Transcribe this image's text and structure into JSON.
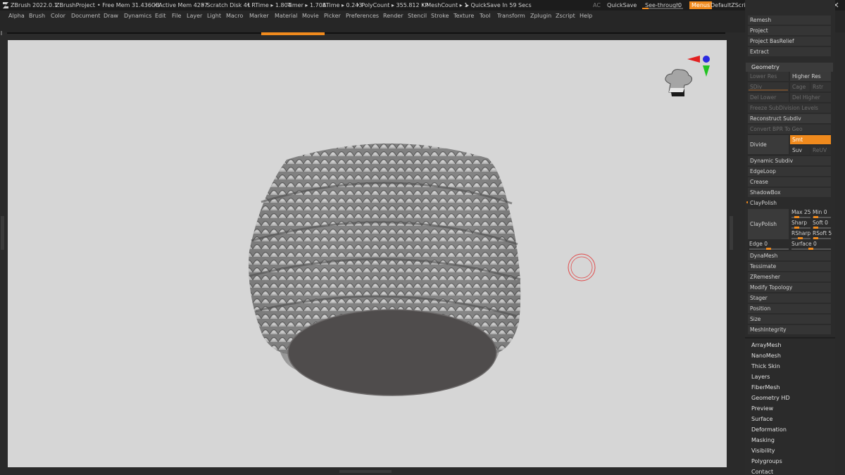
{
  "app": {
    "version": "ZBrush 2022.0.1",
    "project": "ZBrushProject",
    "status": {
      "free_mem": "• Free Mem 31.436GB",
      "active_mem": "• Active Mem 4287",
      "scratch_disk": "• Scratch Disk 41",
      "rtime": "• RTime ▸ 1.804",
      "timer": "Timer ▸ 1.708",
      "atime": "ATime ▸ 0.243",
      "polycount": "• PolyCount ▸ 355.812 KP",
      "meshcount": "• MeshCount ▸ 1",
      "quicksave_timer": "▸ QuickSave In 59 Secs"
    },
    "ac_label": "AC",
    "quicksave_button": "QuickSave",
    "see_through_label": "See-through",
    "see_through_value": "0",
    "menus_button": "Menus",
    "zscript_name": "DefaultZScript"
  },
  "menubar": [
    "Alpha",
    "Brush",
    "Color",
    "Document",
    "Draw",
    "Dynamics",
    "Edit",
    "File",
    "Layer",
    "Light",
    "Macro",
    "Marker",
    "Material",
    "Movie",
    "Picker",
    "Preferences",
    "Render",
    "Stencil",
    "Stroke",
    "Texture",
    "Tool",
    "Transform",
    "Zplugin",
    "Zscript",
    "Help"
  ],
  "panel": {
    "top_items": [
      "Remesh",
      "Project",
      "Project BasRelief",
      "Extract"
    ],
    "geometry_header": "Geometry",
    "lower_res": "Lower Res",
    "higher_res": "Higher Res",
    "sdiv": "SDiv",
    "cage": "Cage",
    "rstr": "Rstr",
    "del_lower": "Del Lower",
    "del_higher": "Del Higher",
    "freeze_subdiv": "Freeze SubDivision Levels",
    "reconstruct_subdiv": "Reconstruct Subdiv",
    "convert_bpr": "Convert BPR To Geo",
    "divide": "Divide",
    "smt": "Smt",
    "suv": "Suv",
    "reuv": "ReUV",
    "dynamic_subdiv": "Dynamic Subdiv",
    "edgeloop": "EdgeLoop",
    "crease": "Crease",
    "shadowbox": "ShadowBox",
    "claypolish_header": "ClayPolish",
    "claypolish_button": "ClayPolish",
    "max_label": "Max 25",
    "min_label": "Min 0",
    "sharp_label": "Sharp",
    "soft_label": "Soft 0",
    "rsharp_label": "RSharp",
    "rsoft_label": "RSoft 5",
    "edge_label": "Edge 0",
    "surface_label": "Surface 0",
    "after_items": [
      "DynaMesh",
      "Tessimate",
      "ZRemesher",
      "Modify Topology",
      "Stager",
      "Position",
      "Size",
      "MeshIntegrity"
    ],
    "list_items": [
      "ArrayMesh",
      "NanoMesh",
      "Thick Skin",
      "Layers",
      "FiberMesh",
      "Geometry HD",
      "Preview",
      "Surface",
      "Deformation",
      "Masking",
      "Visibility",
      "Polygroups",
      "Contact"
    ],
    "accent_color": "#f08a1d"
  }
}
